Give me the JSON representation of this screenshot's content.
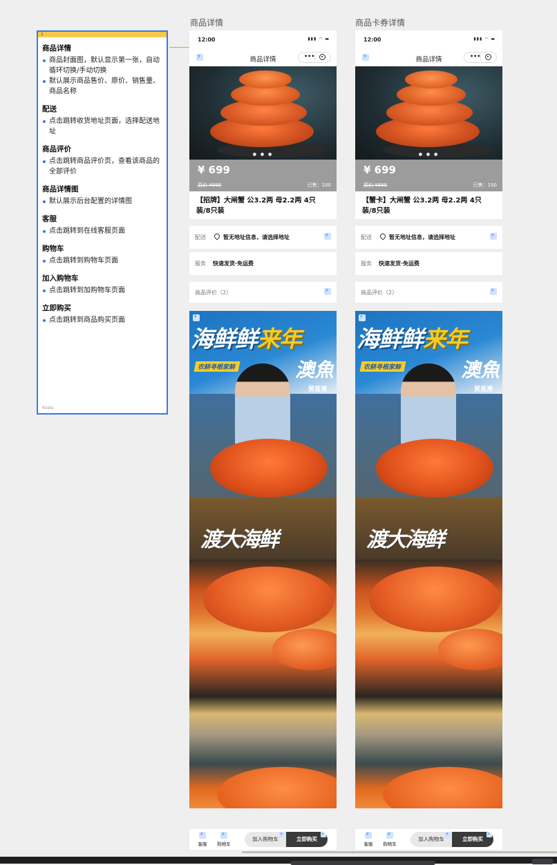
{
  "canvas": {
    "left_title": "商品详情",
    "right_title": "商品卡券详情"
  },
  "annotation": {
    "tag": "1",
    "footer": "Koala",
    "sections": [
      {
        "heading": "商品详情",
        "items": [
          "商品封面图，默认显示第一张，自动循环切换/手动切换",
          "默认展示商品售价、原价、销售量、商品名称"
        ]
      },
      {
        "heading": "配送",
        "items": [
          "点击跳转收货地址页面，选择配送地址"
        ]
      },
      {
        "heading": "商品评价",
        "items": [
          "点击跳转商品评价页，查看该商品的全部评价"
        ]
      },
      {
        "heading": "商品详情图",
        "items": [
          "默认展示后台配置的详情图"
        ]
      },
      {
        "heading": "客服",
        "items": [
          "点击跳转到在线客服页面"
        ]
      },
      {
        "heading": "购物车",
        "items": [
          "点击跳转到购物车页面"
        ]
      },
      {
        "heading": "加入购物车",
        "items": [
          "点击跳转到加购物车页面"
        ]
      },
      {
        "heading": "立即购买",
        "items": [
          "点击跳转到商品购买页面"
        ]
      }
    ]
  },
  "phones": [
    {
      "time": "12:00",
      "nav_title": "商品详情",
      "capsule_more": "•••",
      "price": "¥ 699",
      "original_price": "原价 ¥999",
      "sold": "已售：100",
      "goods_name": "【招牌】大闸蟹 公3.2两 母2.2两  4只装/8只装",
      "delivery_label": "配送",
      "delivery_value": "暂无地址信息，请选择地址",
      "service_label": "服务",
      "service_value": "快速发货·免运费",
      "review_label": "商品评价（2）",
      "detail_headline_a": "海鲜鲜",
      "detail_headline_b": "来年",
      "detail_sub": "农耕寻根家鲜",
      "detail_char": "澳魚",
      "detail_small": "贸易港",
      "detail_brush": "渡大海鲜",
      "tab_service": "客服",
      "tab_cart": "购物车",
      "add_cart": "加入购物车",
      "buy_now": "立即购买"
    },
    {
      "time": "12:00",
      "nav_title": "商品详情",
      "capsule_more": "•••",
      "price": "¥ 699",
      "original_price": "原价 ¥999",
      "sold": "已售：100",
      "goods_name": "【蟹卡】大闸蟹 公3.2两 母2.2两  4只装/8只装",
      "delivery_label": "配送",
      "delivery_value": "暂无地址信息，请选择地址",
      "service_label": "服务",
      "service_value": "快速发货·免运费",
      "review_label": "商品评价（2）",
      "detail_headline_a": "海鲜鲜",
      "detail_headline_b": "来年",
      "detail_sub": "农耕寻根家鲜",
      "detail_char": "澳魚",
      "detail_small": "贸易港",
      "detail_brush": "渡大海鲜",
      "tab_service": "客服",
      "tab_cart": "购物车",
      "add_cart": "加入购物车",
      "buy_now": "立即购买"
    }
  ],
  "colors": {
    "annotation_border": "#3a78e0",
    "annotation_tag_bar": "#f6c94a",
    "price_bar": "#9c9c9c",
    "buy_button": "#3a3a3a"
  },
  "icons": [
    "flash-icon",
    "location-pin-icon",
    "more-icon",
    "close-target-icon",
    "signal-icon",
    "wifi-icon",
    "battery-icon"
  ]
}
